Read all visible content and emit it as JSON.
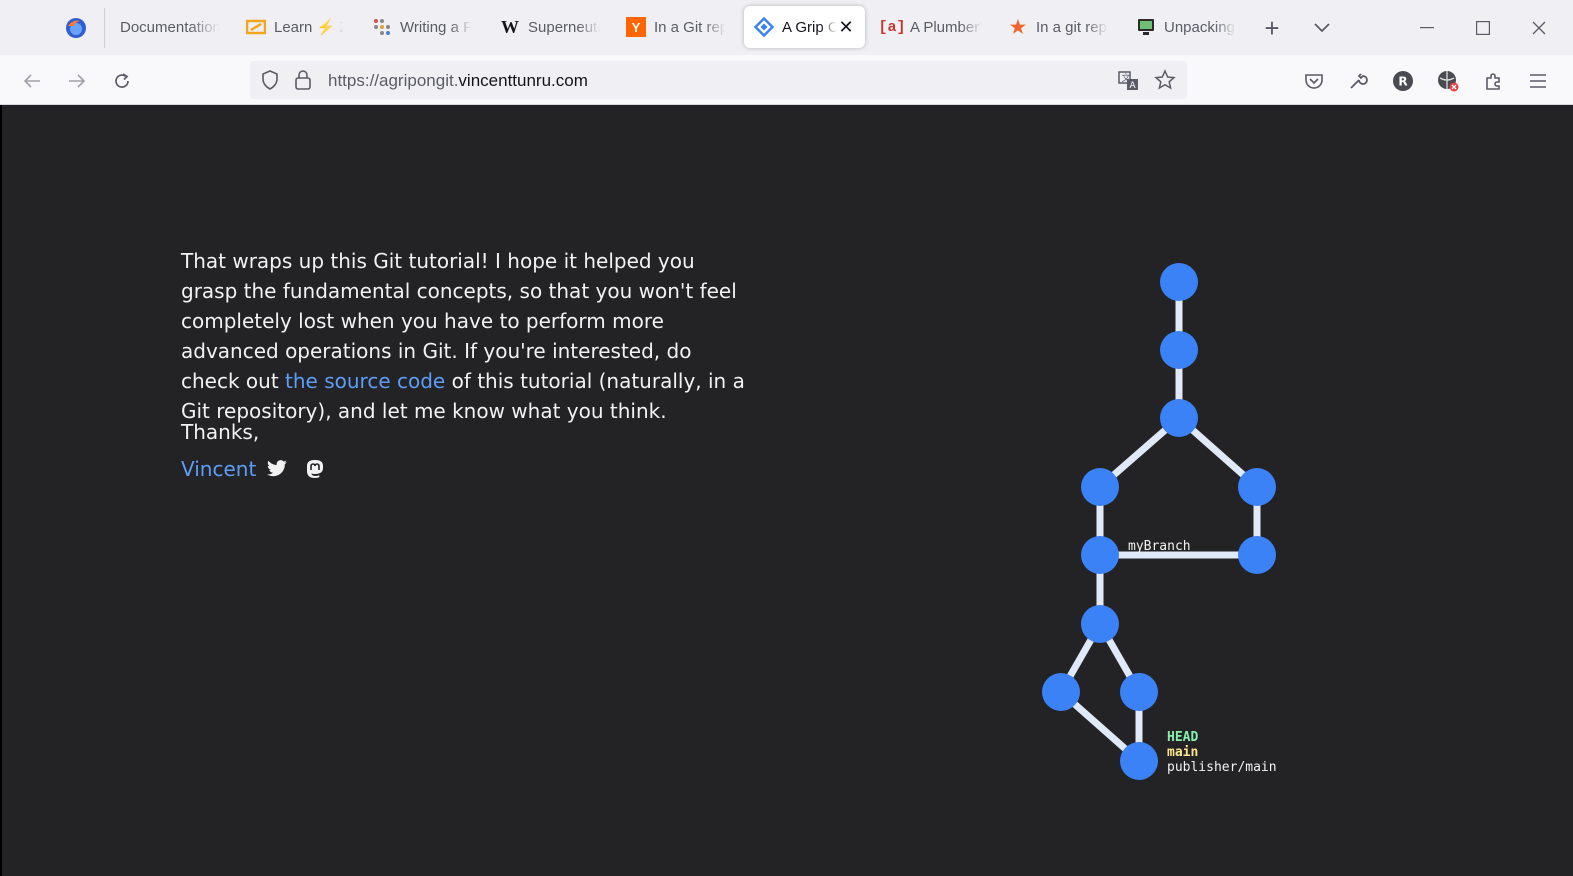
{
  "tabs": [
    {
      "label": "Documentation",
      "icon": "doc-icon"
    },
    {
      "label": "Learn ⚡ Zig",
      "icon": "ziglearn-icon"
    },
    {
      "label": "Writing a Fuzzer",
      "icon": "grid-dots-icon"
    },
    {
      "label": "Superneutrino",
      "icon": "wikipedia-icon"
    },
    {
      "label": "In a Git repository",
      "icon": "ycombinator-icon"
    },
    {
      "label": "A Grip On Git",
      "icon": "git-diamond-icon",
      "active": true
    },
    {
      "label": "A Plumber's Guide",
      "icon": "bracket-a-icon"
    },
    {
      "label": "In a git repository",
      "icon": "star-icon"
    },
    {
      "label": "Unpacking",
      "icon": "monitor-icon"
    }
  ],
  "url": {
    "prefix": "https://agripongit.",
    "host": "vincenttunru.com"
  },
  "content": {
    "p1_before": "That wraps up this Git tutorial! I hope it helped you grasp the fundamental concepts, so that you won't feel completely lost when you have to perform more advanced operations in Git. If you're interested, do check out ",
    "p1_link": "the source code",
    "p1_after": " of this tutorial (naturally, in a Git repository), and let me know what you think.",
    "thanks": "Thanks,",
    "author": "Vincent"
  },
  "graph": {
    "branch_label": "myBranch",
    "head_label": "HEAD",
    "main_label": "main",
    "remote_label": "publisher/main",
    "node_color": "#3b82f6",
    "edge_color": "#dfe9f8",
    "head_color": "#86efac",
    "main_color": "#fde68a"
  }
}
